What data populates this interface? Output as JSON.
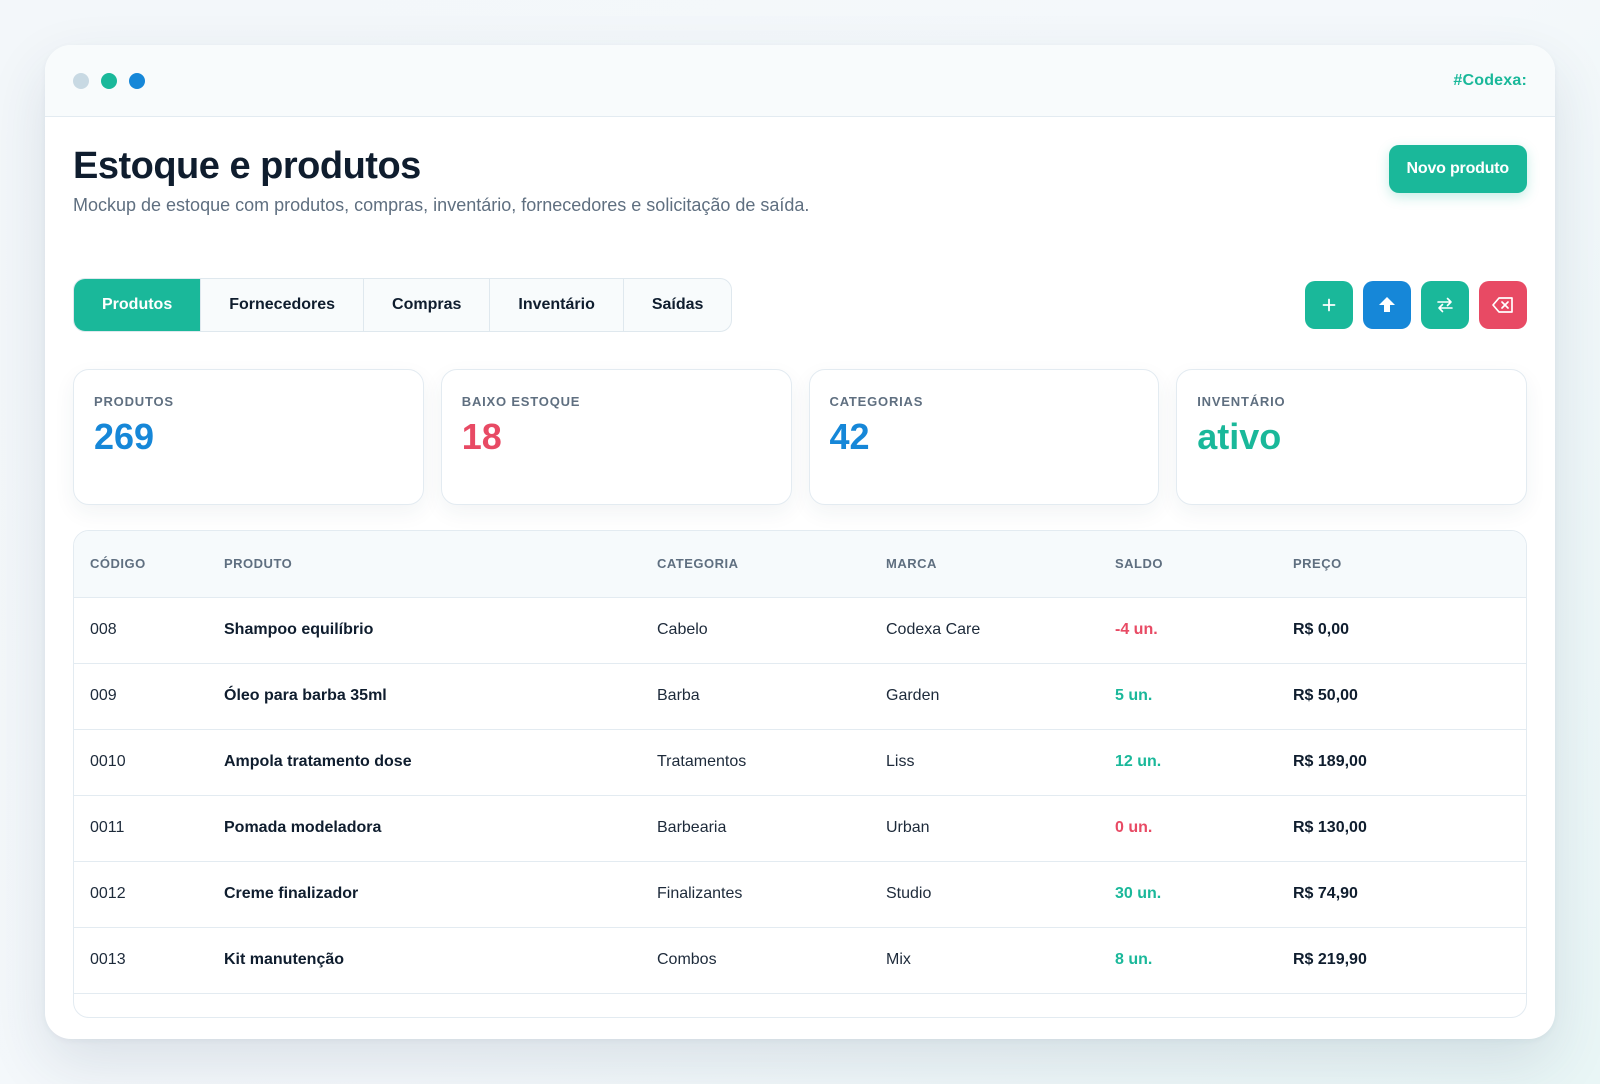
{
  "window": {
    "dots": [
      "#c8d9e3",
      "#1ab89a",
      "#1687d8"
    ],
    "brand": "#Codexa:",
    "brand_color": "#1ab89a"
  },
  "header": {
    "title": "Estoque e produtos",
    "subtitle": "Mockup de estoque com produtos, compras, inventário, fornecedores e solicitação de saída.",
    "new_button": "Novo produto"
  },
  "colors": {
    "accent": "#1ab89a",
    "blue": "#1687d8",
    "red": "#e84a64",
    "dark": "#0f1d2e",
    "muted": "#5f6f80"
  },
  "tabs": [
    {
      "label": "Produtos",
      "active": true
    },
    {
      "label": "Fornecedores",
      "active": false
    },
    {
      "label": "Compras",
      "active": false
    },
    {
      "label": "Inventário",
      "active": false
    },
    {
      "label": "Saídas",
      "active": false
    }
  ],
  "actions": [
    {
      "name": "add-icon",
      "color": "#1ab89a"
    },
    {
      "name": "upload-icon",
      "color": "#1687d8"
    },
    {
      "name": "swap-icon",
      "color": "#1ab89a"
    },
    {
      "name": "backspace-icon",
      "color": "#e84a64"
    }
  ],
  "stats": [
    {
      "label": "PRODUTOS",
      "value": "269",
      "color": "#1687d8"
    },
    {
      "label": "BAIXO ESTOQUE",
      "value": "18",
      "color": "#e84a64"
    },
    {
      "label": "CATEGORIAS",
      "value": "42",
      "color": "#1687d8"
    },
    {
      "label": "INVENTÁRIO",
      "value": "ativo",
      "color": "#1ab89a"
    }
  ],
  "table": {
    "columns": [
      "CÓDIGO",
      "PRODUTO",
      "CATEGORIA",
      "MARCA",
      "SALDO",
      "PREÇO"
    ],
    "rows": [
      {
        "code": "008",
        "product": "Shampoo equilíbrio",
        "category": "Cabelo",
        "brand": "Codexa Care",
        "balance": "-4 un.",
        "status": "low",
        "price": "R$ 0,00"
      },
      {
        "code": "009",
        "product": "Óleo para barba 35ml",
        "category": "Barba",
        "brand": "Garden",
        "balance": "5 un.",
        "status": "ok",
        "price": "R$ 50,00"
      },
      {
        "code": "0010",
        "product": "Ampola tratamento dose",
        "category": "Tratamentos",
        "brand": "Liss",
        "balance": "12 un.",
        "status": "ok",
        "price": "R$ 189,00"
      },
      {
        "code": "0011",
        "product": "Pomada modeladora",
        "category": "Barbearia",
        "brand": "Urban",
        "balance": "0 un.",
        "status": "low",
        "price": "R$ 130,00"
      },
      {
        "code": "0012",
        "product": "Creme finalizador",
        "category": "Finalizantes",
        "brand": "Studio",
        "balance": "30 un.",
        "status": "ok",
        "price": "R$ 74,90"
      },
      {
        "code": "0013",
        "product": "Kit manutenção",
        "category": "Combos",
        "brand": "Mix",
        "balance": "8 un.",
        "status": "ok",
        "price": "R$ 219,90"
      }
    ]
  }
}
